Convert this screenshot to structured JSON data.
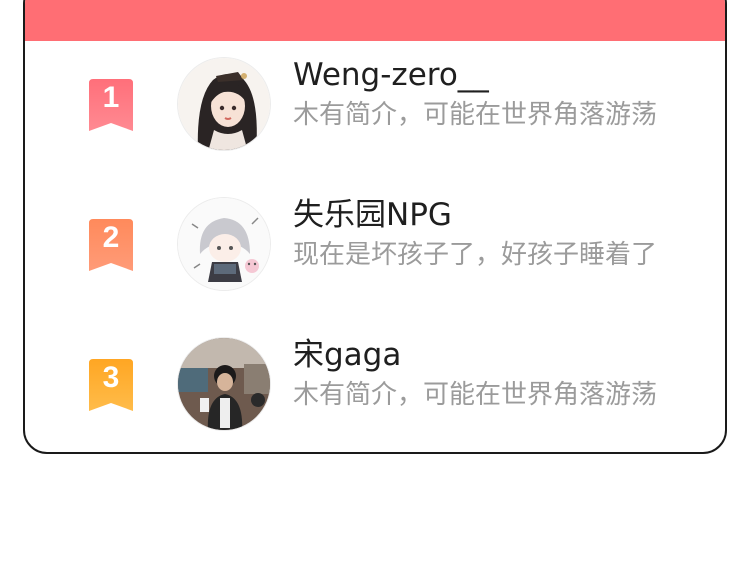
{
  "theme": {
    "header_color": "#ff6e74",
    "rank_colors": [
      "#ff6f7a",
      "#ff8a5b",
      "#ffae2a"
    ]
  },
  "leaderboard": {
    "rows": [
      {
        "rank": "1",
        "name": "Weng-zero__",
        "bio": "木有简介，可能在世界角落游荡",
        "avatar_icon": "anime-girl-avatar"
      },
      {
        "rank": "2",
        "name": "失乐园NPG",
        "bio": "现在是坏孩子了，好孩子睡着了",
        "avatar_icon": "chibi-girl-avatar"
      },
      {
        "rank": "3",
        "name": "宋gaga",
        "bio": "木有简介，可能在世界角落游荡",
        "avatar_icon": "photo-person-avatar"
      }
    ]
  }
}
